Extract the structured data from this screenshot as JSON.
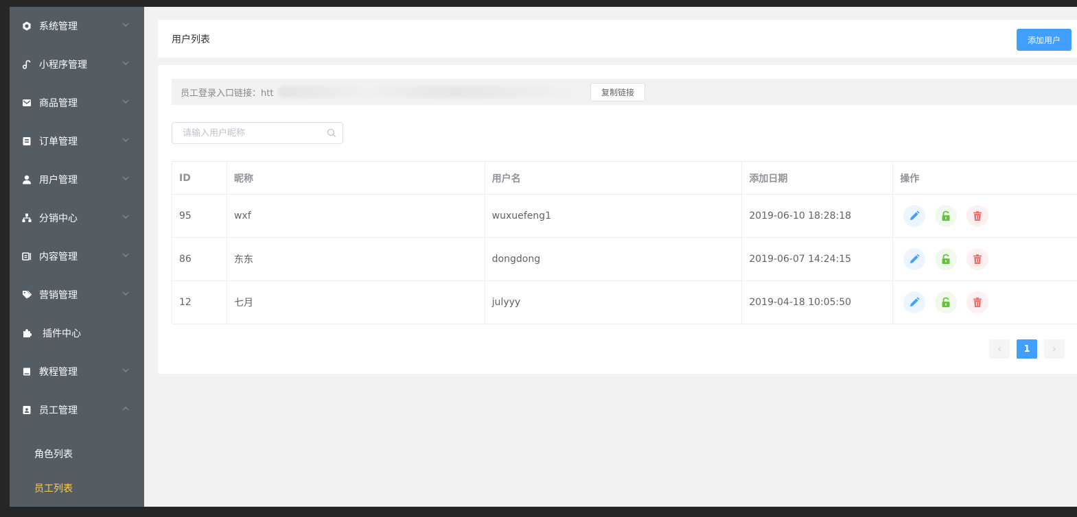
{
  "sidebar": {
    "items": [
      {
        "label": "系统管理",
        "icon": "settings-icon"
      },
      {
        "label": "小程序管理",
        "icon": "music-note-icon"
      },
      {
        "label": "商品管理",
        "icon": "envelope-icon"
      },
      {
        "label": "订单管理",
        "icon": "clipboard-icon"
      },
      {
        "label": "用户管理",
        "icon": "user-icon"
      },
      {
        "label": "分销中心",
        "icon": "sitemap-icon"
      },
      {
        "label": "内容管理",
        "icon": "content-icon"
      },
      {
        "label": "营销管理",
        "icon": "tags-icon"
      },
      {
        "label": "插件中心",
        "icon": "puzzle-icon"
      },
      {
        "label": "教程管理",
        "icon": "book-icon"
      },
      {
        "label": "员工管理",
        "icon": "staff-badge-icon"
      }
    ],
    "sub_items": [
      {
        "label": "角色列表",
        "active": false
      },
      {
        "label": "员工列表",
        "active": true
      }
    ]
  },
  "header": {
    "title": "用户列表",
    "add_button": "添加用户"
  },
  "link_bar": {
    "label": "员工登录入口链接：htt",
    "copy_button": "复制链接"
  },
  "search": {
    "placeholder": "请输入用户昵称"
  },
  "table": {
    "headers": {
      "id": "ID",
      "nickname": "昵称",
      "username": "用户名",
      "date": "添加日期",
      "actions": "操作"
    },
    "rows": [
      {
        "id": "95",
        "nickname": "wxf",
        "username": "wuxuefeng1",
        "date": "2019-06-10 18:28:18"
      },
      {
        "id": "86",
        "nickname": "东东",
        "username": "dongdong",
        "date": "2019-06-07 14:24:15"
      },
      {
        "id": "12",
        "nickname": "七月",
        "username": "julyyy",
        "date": "2019-04-18 10:05:50"
      }
    ]
  },
  "pagination": {
    "prev": "‹",
    "current_page": "1",
    "next": "›"
  },
  "colors": {
    "primary": "#409eff",
    "sidebar_bg": "#545c64",
    "active_menu": "#ffd04b",
    "edit": "#409eff",
    "lock": "#67c23a",
    "delete": "#f56c6c"
  }
}
